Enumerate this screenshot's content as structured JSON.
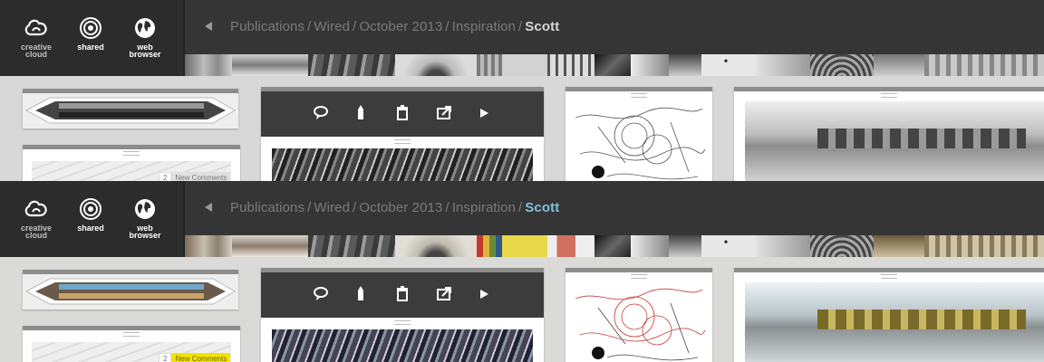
{
  "app_bar": {
    "buttons": [
      {
        "id": "creative_cloud",
        "label": "creative\ncloud",
        "icon": "creative-cloud-icon"
      },
      {
        "id": "shared",
        "label": "shared",
        "icon": "shared-target-icon"
      },
      {
        "id": "web_browser",
        "label": "web\nbrowser",
        "icon": "globe-icon"
      }
    ]
  },
  "breadcrumb": {
    "back_icon": "back-arrow-icon",
    "items": [
      "Publications",
      "Wired",
      "October 2013",
      "Inspiration"
    ],
    "current": "Scott"
  },
  "card_toolbar": {
    "tools": [
      "comment-icon",
      "pen-icon",
      "trash-icon",
      "share-icon",
      "play-icon"
    ]
  },
  "comments": {
    "count": "2",
    "label": "New Comments"
  },
  "colors": {
    "app_bar_bg": "#2c2c2c",
    "nav_bar_bg": "#353535",
    "current_crumb_top": "#d8d8d8",
    "current_crumb_bottom": "#7fc1e0",
    "new_comments_highlight": "#f4e400"
  }
}
